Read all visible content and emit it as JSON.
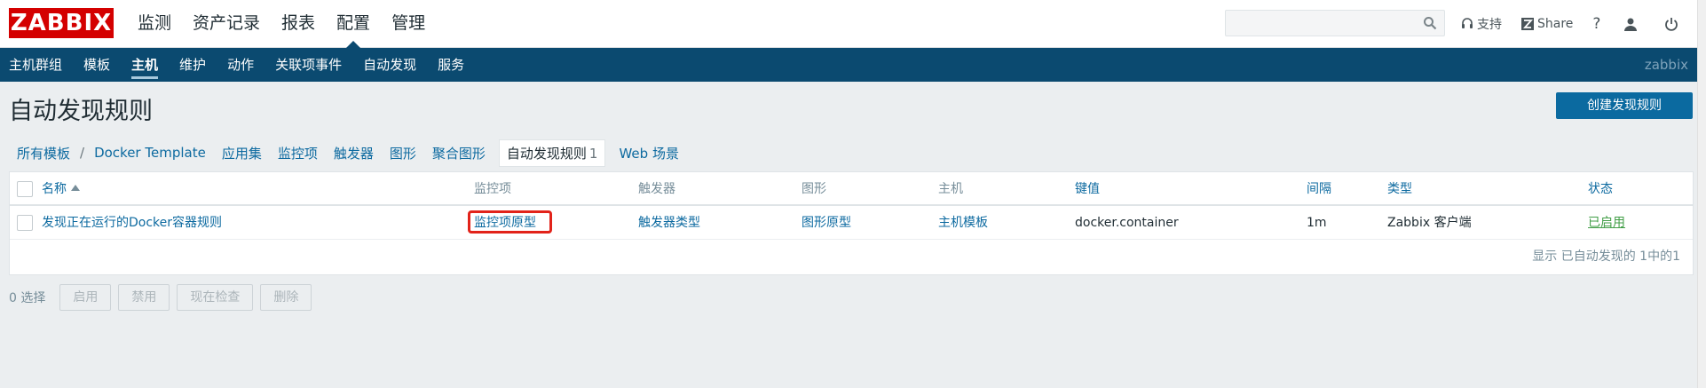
{
  "logo": "ZABBIX",
  "main_menu": [
    "监测",
    "资产记录",
    "报表",
    "配置",
    "管理"
  ],
  "main_menu_active": 3,
  "search": {
    "placeholder": ""
  },
  "top_links": {
    "support": "支持",
    "share": "Share"
  },
  "sub_menu": [
    "主机群组",
    "模板",
    "主机",
    "维护",
    "动作",
    "关联项事件",
    "自动发现",
    "服务"
  ],
  "sub_menu_active": 2,
  "sub_user": "zabbix",
  "page_title": "自动发现规则",
  "create_button": "创建发现规则",
  "breadcrumbs": {
    "all_templates": "所有模板",
    "sep": "/",
    "template": "Docker Template",
    "apps": "应用集",
    "items": "监控项",
    "triggers": "触发器",
    "graphs": "图形",
    "screens": "聚合图形",
    "discovery": "自动发现规则",
    "discovery_count": "1",
    "web": "Web 场景"
  },
  "table": {
    "headers": {
      "name": "名称",
      "items": "监控项",
      "triggers": "触发器",
      "graphs": "图形",
      "hosts": "主机",
      "key": "键值",
      "interval": "间隔",
      "type": "类型",
      "status": "状态"
    },
    "row": {
      "name": "发现正在运行的Docker容器规则",
      "items": "监控项原型",
      "triggers": "触发器类型",
      "graphs": "图形原型",
      "hosts": "主机模板",
      "key": "docker.container",
      "interval": "1m",
      "type": "Zabbix 客户端",
      "status": "已启用"
    },
    "footer": "显示 已自动发现的 1中的1"
  },
  "bottom": {
    "selected": "0 选择",
    "enable": "启用",
    "disable": "禁用",
    "check_now": "现在检查",
    "delete": "删除"
  },
  "colors": {
    "brand_red": "#d40000",
    "nav_blue": "#0b4a70",
    "link_blue": "#0d6aa0",
    "enabled_green": "#429e47",
    "highlight_red": "#e2231a"
  }
}
